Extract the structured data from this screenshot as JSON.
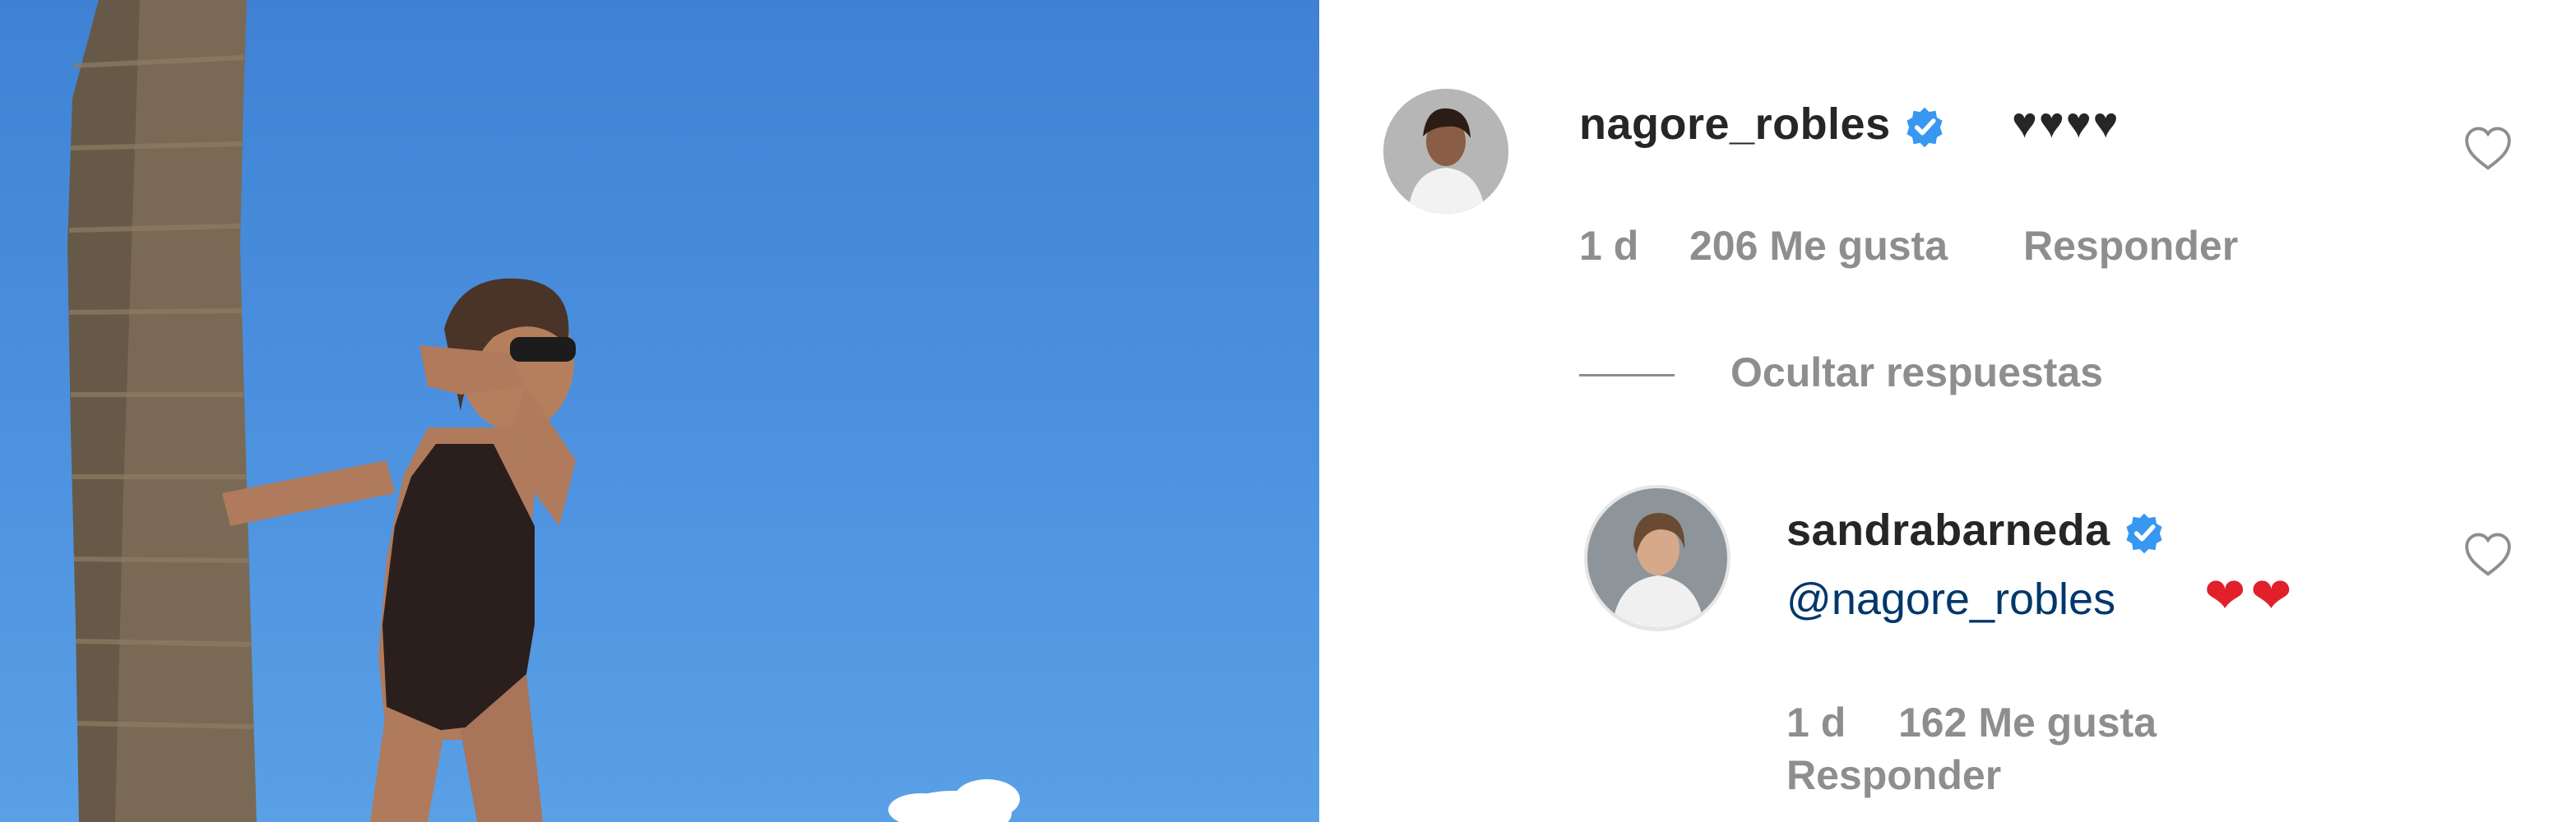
{
  "comment1": {
    "username": "nagore_robles",
    "text": "♥♥♥♥",
    "time": "1 d",
    "likes": "206 Me gusta",
    "reply_label": "Responder"
  },
  "replies_toggle": "Ocultar respuestas",
  "reply1": {
    "username": "sandrabarneda",
    "mention": "@nagore_robles",
    "hearts": "❤❤",
    "time": "1 d",
    "likes": "162 Me gusta",
    "reply_label": "Responder"
  },
  "colors": {
    "sky": "#4a8fdd",
    "verified": "#3897f0",
    "mention": "#00376b",
    "meta": "#8e8e8e",
    "heart_red": "#e0202b"
  }
}
